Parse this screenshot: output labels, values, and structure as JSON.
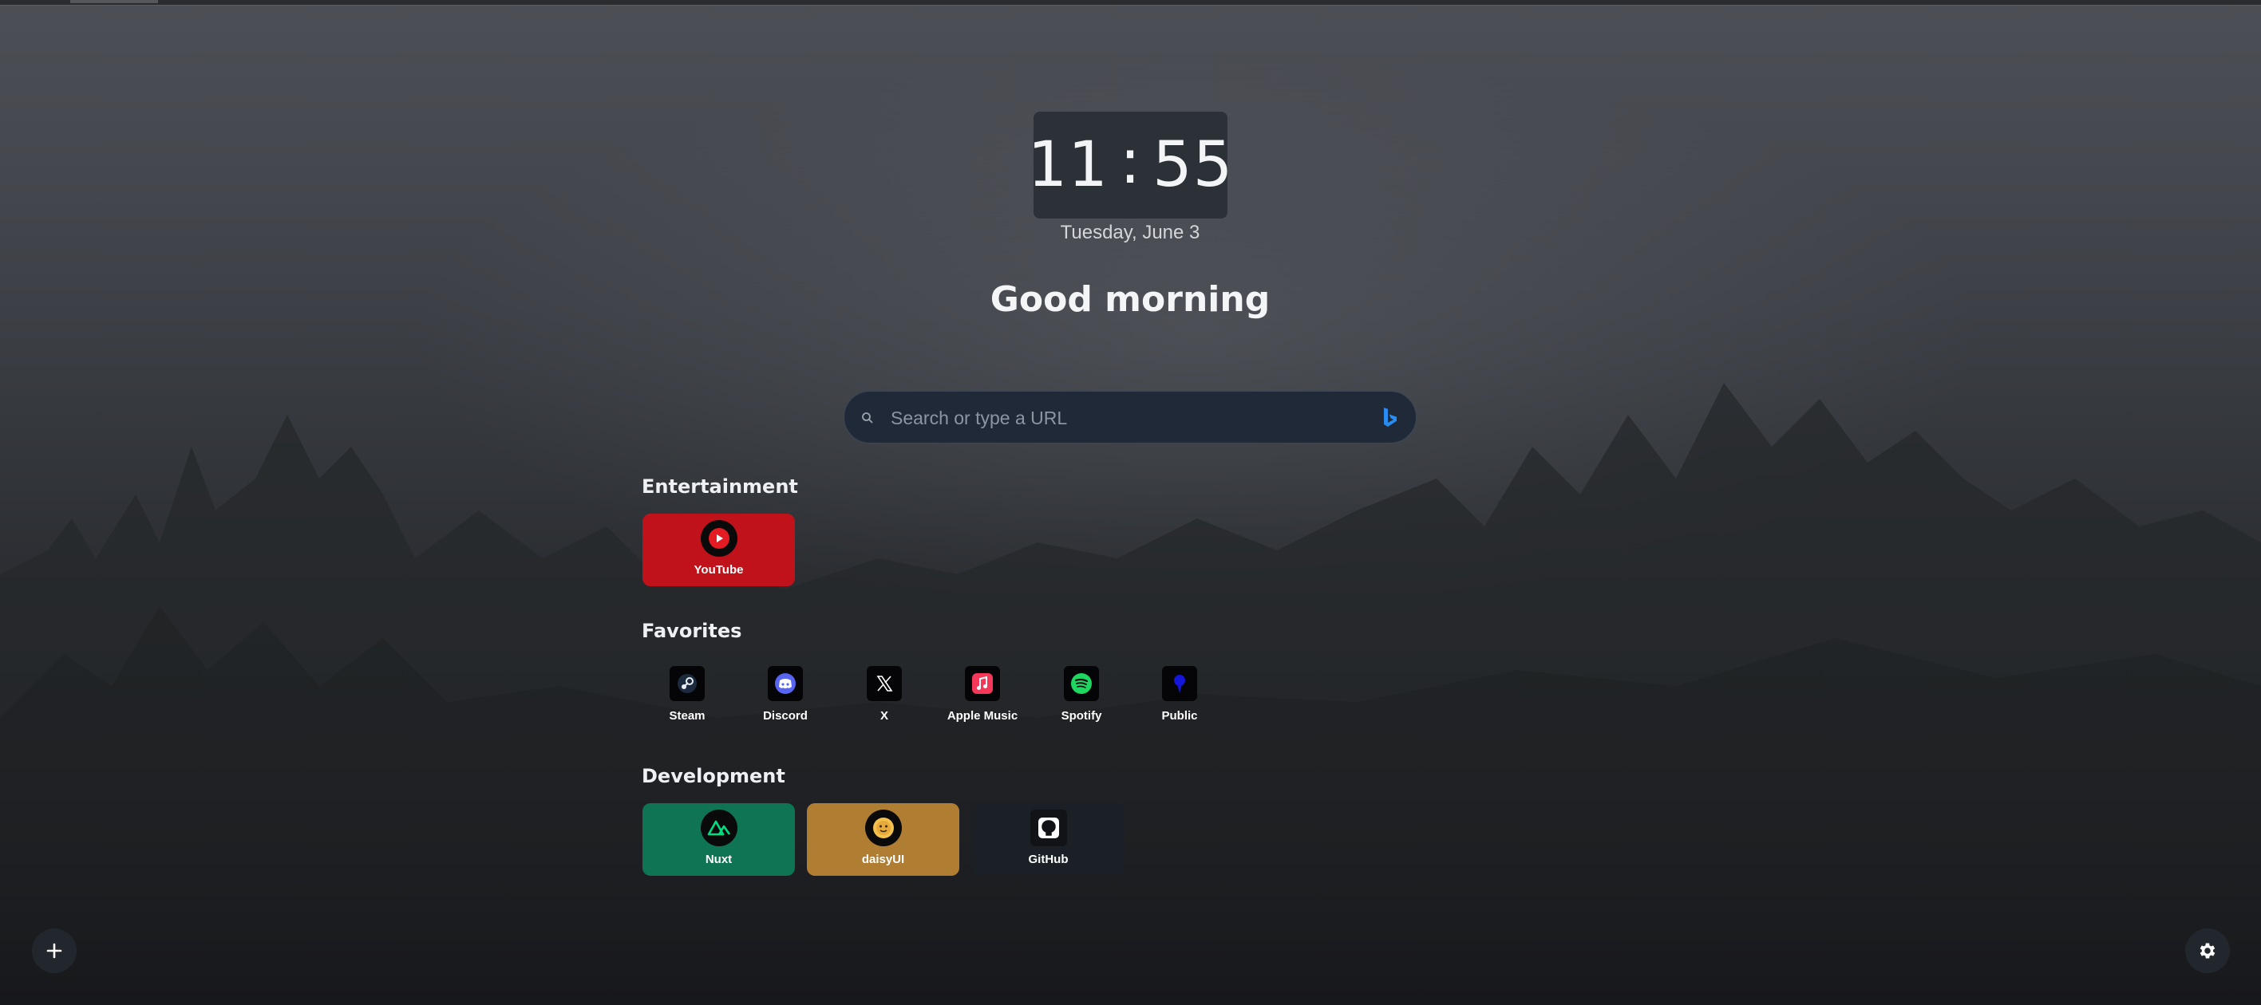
{
  "clock": {
    "hours": "11",
    "separator": ":",
    "minutes": "55"
  },
  "date": "Tuesday, June 3",
  "greeting": "Good morning",
  "search": {
    "placeholder": "Search or type a URL",
    "engine_icon": "bing-icon"
  },
  "sections": {
    "entertainment": {
      "title": "Entertainment",
      "items": [
        {
          "label": "YouTube",
          "icon": "youtube-icon",
          "color": "#c0121a"
        }
      ]
    },
    "favorites": {
      "title": "Favorites",
      "items": [
        {
          "label": "Steam",
          "icon": "steam-icon"
        },
        {
          "label": "Discord",
          "icon": "discord-icon"
        },
        {
          "label": "X",
          "icon": "x-icon"
        },
        {
          "label": "Apple Music",
          "icon": "apple-music-icon"
        },
        {
          "label": "Spotify",
          "icon": "spotify-icon"
        },
        {
          "label": "Public",
          "icon": "public-icon"
        }
      ]
    },
    "development": {
      "title": "Development",
      "items": [
        {
          "label": "Nuxt",
          "icon": "nuxt-icon",
          "color": "#0e7453"
        },
        {
          "label": "daisyUI",
          "icon": "daisyui-icon",
          "color": "#b07e33"
        },
        {
          "label": "GitHub",
          "icon": "github-icon",
          "color": "#1b1f26"
        }
      ]
    }
  },
  "buttons": {
    "add": "plus-icon",
    "settings": "gear-icon"
  },
  "colors": {
    "search_bg": "#1f2937",
    "clock_bg": "#2c3138",
    "bing_blue": "#2a8cf0"
  }
}
